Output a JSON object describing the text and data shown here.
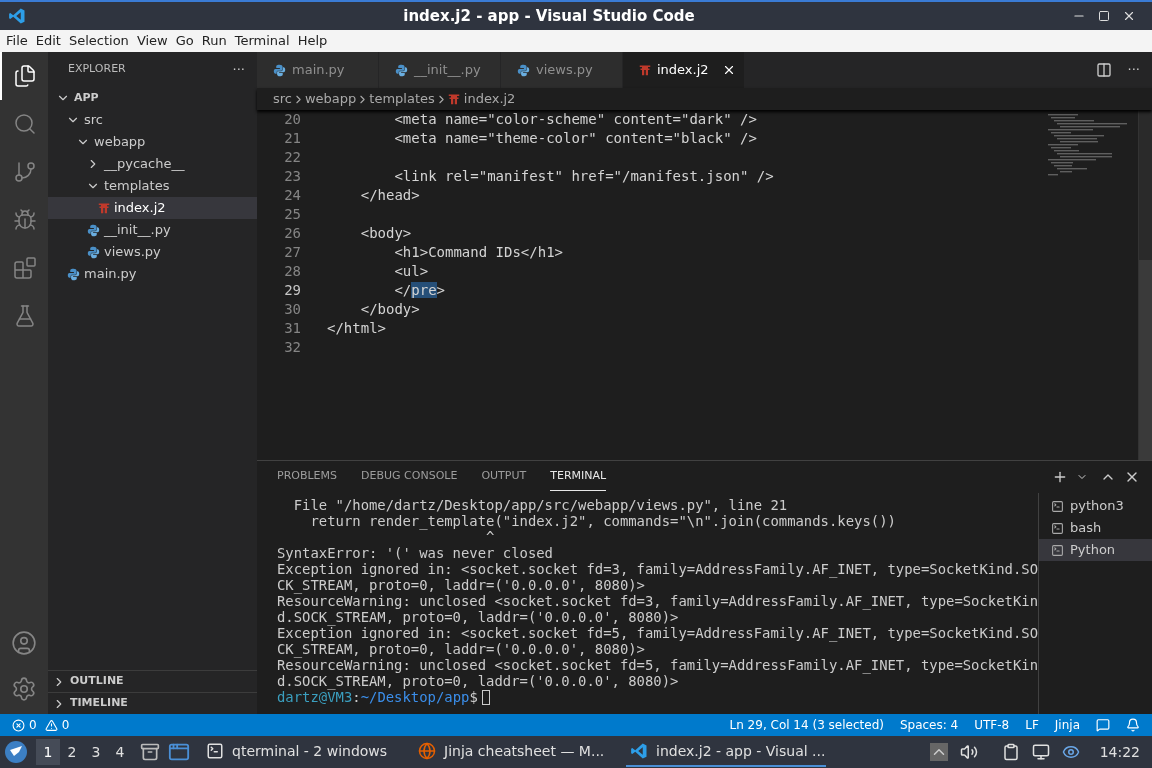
{
  "window": {
    "title": "index.j2 - app - Visual Studio Code"
  },
  "menu": [
    "File",
    "Edit",
    "Selection",
    "View",
    "Go",
    "Run",
    "Terminal",
    "Help"
  ],
  "activity_bar": [
    {
      "kind": "files",
      "selected": true
    },
    {
      "kind": "search",
      "selected": false
    },
    {
      "kind": "source-control",
      "selected": false
    },
    {
      "kind": "debug",
      "selected": false
    },
    {
      "kind": "extensions",
      "selected": false
    },
    {
      "kind": "testing",
      "selected": false
    }
  ],
  "sidebar": {
    "title": "EXPLORER",
    "more": "···",
    "tree": [
      {
        "label": "APP",
        "kind": "root",
        "expanded": true,
        "selected": false,
        "children": [
          {
            "label": "src",
            "kind": "folder",
            "expanded": true,
            "selected": false,
            "children": [
              {
                "label": "webapp",
                "kind": "folder",
                "expanded": true,
                "selected": false,
                "children": [
                  {
                    "label": "__pycache__",
                    "kind": "folder",
                    "expanded": false,
                    "selected": false
                  },
                  {
                    "label": "templates",
                    "kind": "folder",
                    "expanded": true,
                    "selected": false,
                    "children": [
                      {
                        "label": "index.j2",
                        "kind": "jinja",
                        "selected": true
                      }
                    ]
                  },
                  {
                    "label": "__init__.py",
                    "kind": "python",
                    "selected": false
                  },
                  {
                    "label": "views.py",
                    "kind": "python",
                    "selected": false
                  }
                ]
              }
            ]
          },
          {
            "label": "main.py",
            "kind": "python",
            "selected": false
          }
        ]
      }
    ],
    "sections": [
      {
        "label": "OUTLINE",
        "expanded": false
      },
      {
        "label": "TIMELINE",
        "expanded": false
      }
    ]
  },
  "tabs": [
    {
      "label": "main.py",
      "kind": "python",
      "selected": false
    },
    {
      "label": "__init__.py",
      "kind": "python",
      "selected": false
    },
    {
      "label": "views.py",
      "kind": "python",
      "selected": false
    },
    {
      "label": "index.j2",
      "kind": "jinja",
      "selected": true
    }
  ],
  "breadcrumbs": [
    {
      "label": "src",
      "kind": "folder"
    },
    {
      "label": "webapp",
      "kind": "folder"
    },
    {
      "label": "templates",
      "kind": "folder"
    },
    {
      "label": "index.j2",
      "kind": "jinja"
    }
  ],
  "editor": {
    "lines": [
      {
        "number": "20",
        "current": false,
        "parts": [
          {
            "text": "        <meta name=\"color-scheme\" content=\"dark\" />",
            "selected": false
          }
        ]
      },
      {
        "number": "21",
        "current": false,
        "parts": [
          {
            "text": "        <meta name=\"theme-color\" content=\"black\" />",
            "selected": false
          }
        ]
      },
      {
        "number": "22",
        "current": false
      },
      {
        "number": "23",
        "current": false,
        "parts": [
          {
            "text": "        <link rel=\"manifest\" href=\"/manifest.json\" />",
            "selected": false
          }
        ]
      },
      {
        "number": "24",
        "current": false,
        "parts": [
          {
            "text": "    </head>",
            "selected": false
          }
        ]
      },
      {
        "number": "25",
        "current": false
      },
      {
        "number": "26",
        "current": false,
        "parts": [
          {
            "text": "    <body>",
            "selected": false
          }
        ]
      },
      {
        "number": "27",
        "current": false,
        "parts": [
          {
            "text": "        <h1>Command IDs</h1>",
            "selected": false
          }
        ]
      },
      {
        "number": "28",
        "current": false,
        "parts": [
          {
            "text": "        <ul>",
            "selected": false
          }
        ]
      },
      {
        "number": "29",
        "current": true,
        "parts": [
          {
            "text": "        </",
            "selected": false
          },
          {
            "text": "pre",
            "selected": true
          },
          {
            "text": ">",
            "selected": false
          }
        ]
      },
      {
        "number": "30",
        "current": false,
        "parts": [
          {
            "text": "    </body>",
            "selected": false
          }
        ]
      },
      {
        "number": "31",
        "current": false,
        "parts": [
          {
            "text": "</html>",
            "selected": false
          }
        ]
      },
      {
        "number": "32",
        "current": false
      }
    ],
    "more": "···"
  },
  "panel": {
    "tabs": [
      {
        "label": "PROBLEMS",
        "selected": false
      },
      {
        "label": "DEBUG CONSOLE",
        "selected": false
      },
      {
        "label": "OUTPUT",
        "selected": false
      },
      {
        "label": "TERMINAL",
        "selected": true
      }
    ],
    "terminal": {
      "lines": [
        "  File \"/home/dartz/Desktop/app/src/webapp/views.py\", line 21",
        "    return render_template(\"index.j2\", commands=\"\\n\".join(commands.keys())",
        "                         ^",
        "SyntaxError: '(' was never closed",
        "Exception ignored in: <socket.socket fd=3, family=AddressFamily.AF_INET, type=SocketKind.SO",
        "CK_STREAM, proto=0, laddr=('0.0.0.0', 8080)>",
        "ResourceWarning: unclosed <socket.socket fd=3, family=AddressFamily.AF_INET, type=SocketKin",
        "d.SOCK_STREAM, proto=0, laddr=('0.0.0.0', 8080)>",
        "Exception ignored in: <socket.socket fd=5, family=AddressFamily.AF_INET, type=SocketKind.SO",
        "CK_STREAM, proto=0, laddr=('0.0.0.0', 8080)>",
        "ResourceWarning: unclosed <socket.socket fd=5, family=AddressFamily.AF_INET, type=SocketKin",
        "d.SOCK_STREAM, proto=0, laddr=('0.0.0.0', 8080)>"
      ],
      "prompt": {
        "user": "dartz@VM3",
        "separator": ":",
        "path": "~/Desktop/app",
        "symbol": "$"
      }
    },
    "terminals": [
      {
        "label": "python3",
        "selected": false
      },
      {
        "label": "bash",
        "selected": false
      },
      {
        "label": "Python",
        "selected": true
      }
    ]
  },
  "status_bar": {
    "errors": "0",
    "warnings": "0",
    "items": [
      "Ln 29, Col 14 (3 selected)",
      "Spaces: 4",
      "UTF-8",
      "LF",
      "Jinja"
    ]
  },
  "taskbar": {
    "workspaces": [
      {
        "label": "1",
        "selected": true
      },
      {
        "label": "2",
        "selected": false
      },
      {
        "label": "3",
        "selected": false
      },
      {
        "label": "4",
        "selected": false
      }
    ],
    "apps": [
      {
        "label": "qterminal - 2 windows",
        "kind": "terminal",
        "selected": false
      },
      {
        "label": "Jinja cheatsheet — M...",
        "kind": "browser",
        "selected": false
      },
      {
        "label": "index.j2 - app - Visual ...",
        "kind": "vscode",
        "selected": true
      }
    ],
    "clock": "14:22"
  }
}
